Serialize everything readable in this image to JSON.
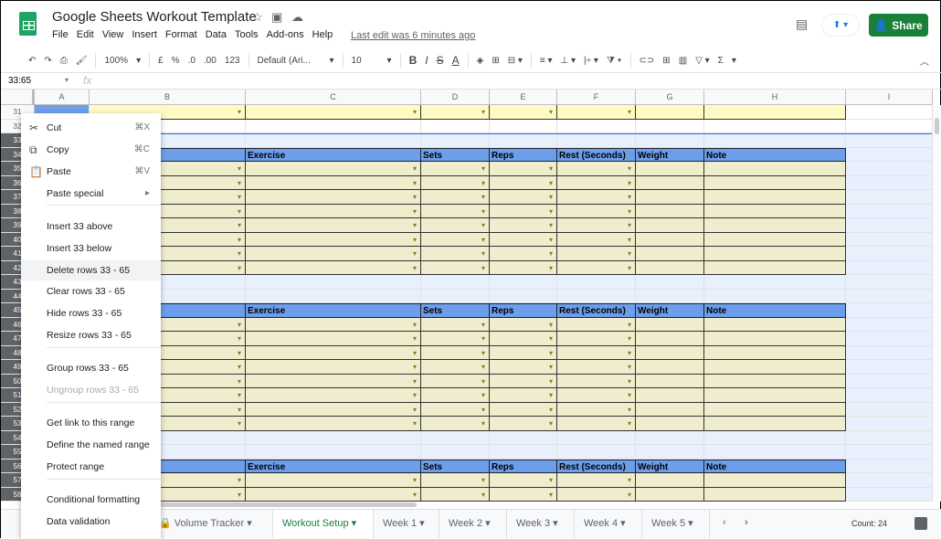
{
  "app": {
    "title": "Google Sheets Workout Template",
    "menu": [
      "File",
      "Edit",
      "View",
      "Insert",
      "Format",
      "Data",
      "Tools",
      "Add-ons",
      "Help"
    ],
    "last_edit": "Last edit was 6 minutes ago",
    "share": "Share"
  },
  "toolbar": {
    "zoom": "100%",
    "currency": "£",
    "percent": "%",
    "dec_less": ".0",
    "dec_more": ".00",
    "format": "123",
    "font": "Default (Ari...",
    "size": "10",
    "bold": "B",
    "italic": "I",
    "strike": "S",
    "textcolor": "A",
    "sum": "Σ"
  },
  "formula": {
    "namebox": "33:65",
    "fx": "fx"
  },
  "columns": [
    "A",
    "B",
    "C",
    "D",
    "E",
    "F",
    "G",
    "H",
    "I"
  ],
  "table_headers": [
    "Exercise",
    "Sets",
    "Reps",
    "Rest (Seconds)",
    "Weight",
    "Note"
  ],
  "rows": {
    "first": 31,
    "last": 58,
    "selected_from": 33,
    "header_rows": [
      34,
      45,
      56
    ],
    "data_rows": [
      35,
      36,
      37,
      38,
      39,
      40,
      41,
      42,
      46,
      47,
      48,
      49,
      50,
      51,
      52,
      53,
      57,
      58
    ],
    "yellow_rows": [
      31
    ]
  },
  "context_menu": [
    {
      "label": "Cut",
      "icon": "scissors-icon",
      "shortcut": "⌘X"
    },
    {
      "label": "Copy",
      "icon": "copy-icon",
      "shortcut": "⌘C"
    },
    {
      "label": "Paste",
      "icon": "clipboard-icon",
      "shortcut": "⌘V"
    },
    {
      "label": "Paste special",
      "submenu": true
    },
    {
      "label": "Insert 33 above"
    },
    {
      "label": "Insert 33 below"
    },
    {
      "label": "Delete rows 33 - 65",
      "highlighted": true
    },
    {
      "label": "Clear rows 33 - 65"
    },
    {
      "label": "Hide rows 33 - 65"
    },
    {
      "label": "Resize rows 33 - 65"
    },
    {
      "label": "Group rows 33 - 65"
    },
    {
      "label": "Ungroup rows 33 - 65",
      "disabled": true
    },
    {
      "label": "Get link to this range"
    },
    {
      "label": "Define the named range"
    },
    {
      "label": "Protect range"
    },
    {
      "label": "Conditional formatting"
    },
    {
      "label": "Data validation"
    }
  ],
  "sheets": [
    {
      "label": "Volume Tracker",
      "locked": true
    },
    {
      "label": "Workout Setup",
      "active": true
    },
    {
      "label": "Week 1"
    },
    {
      "label": "Week 2"
    },
    {
      "label": "Week 3"
    },
    {
      "label": "Week 4"
    },
    {
      "label": "Week 5"
    }
  ],
  "status": {
    "count": "Count: 24"
  },
  "colors": {
    "header_blue": "#6d9eeb",
    "data_tan": "#efedcd",
    "yellow": "#fff9c4",
    "share_green": "#188038",
    "selection": "#e8f0fe"
  }
}
